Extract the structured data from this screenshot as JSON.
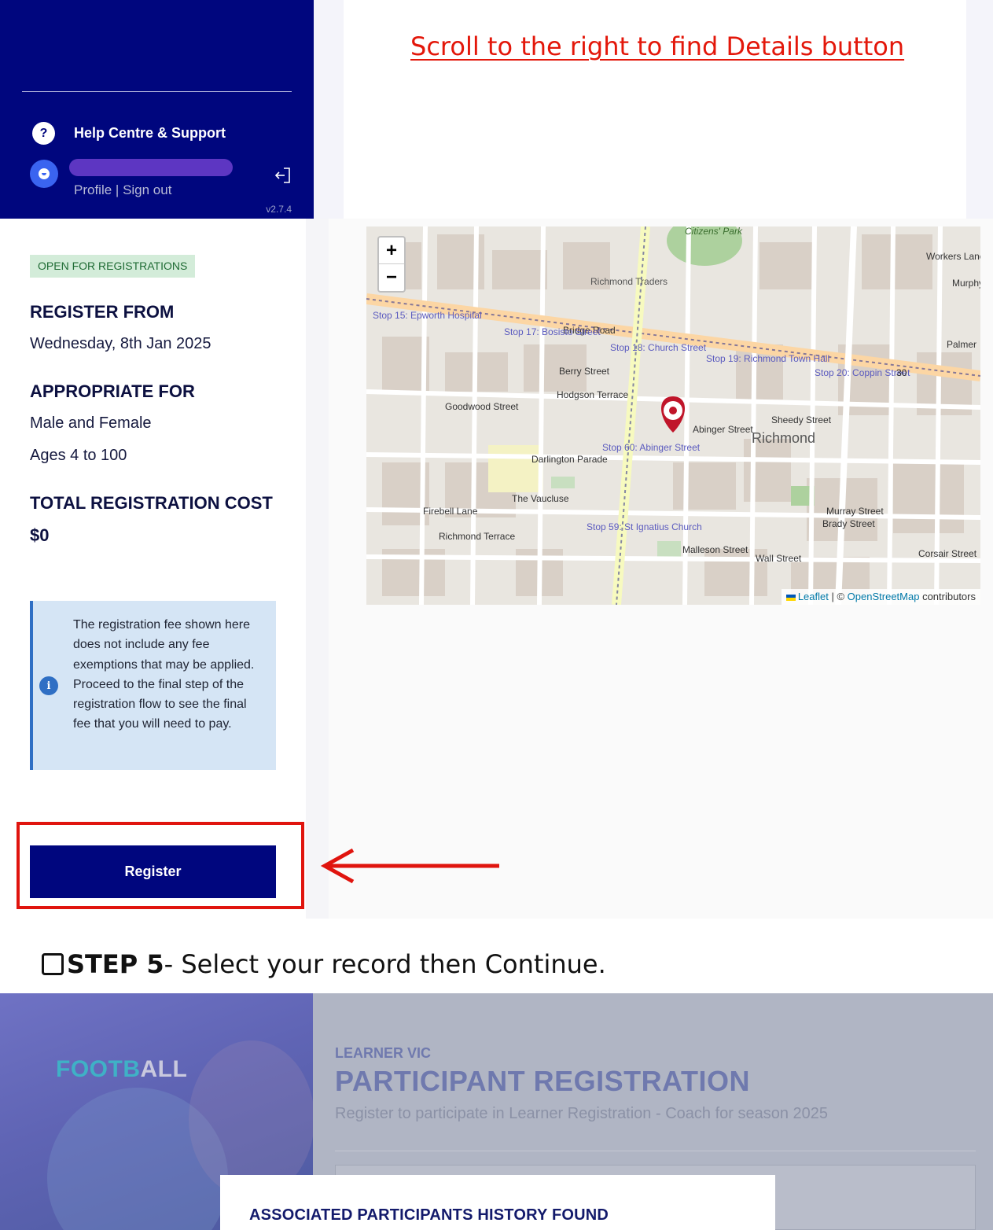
{
  "sidebar": {
    "help_label": "Help Centre & Support",
    "help_icon_glyph": "?",
    "profile_link": "Profile",
    "separator": " | ",
    "signout_link": "Sign out",
    "version": "v2.7.4"
  },
  "annotation": {
    "scroll_note": "Scroll to the right to find Details button"
  },
  "details": {
    "status_badge": "OPEN FOR REGISTRATIONS",
    "register_from_label": "REGISTER FROM",
    "register_from_value": "Wednesday, 8th Jan 2025",
    "appropriate_for_label": "APPROPRIATE FOR",
    "gender_value": "Male and Female",
    "ages_value": "Ages 4 to 100",
    "cost_label": "TOTAL REGISTRATION COST",
    "cost_value": "$0",
    "info_text": "The registration fee shown here does not include any fee exemptions that may be applied. Proceed to the final step of the registration flow to see the final fee that you will need to pay.",
    "info_icon_glyph": "i",
    "register_button": "Register"
  },
  "map": {
    "zoom_in": "+",
    "zoom_out": "−",
    "attribution_leaflet": "Leaflet",
    "attribution_sep": " | © ",
    "attribution_osm": "OpenStreetMap",
    "attribution_contributors": " contributors",
    "labels": {
      "citizens_park": "Citizens' Park",
      "richmond_traders": "Richmond Traders",
      "bridge_road": "Bridge Road",
      "stop15": "Stop 15: Epworth Hospital",
      "stop17": "Stop 17: Bosisto Street",
      "stop18": "Stop 18: Church Street",
      "stop19": "Stop 19: Richmond Town Hall",
      "stop20": "Stop 20: Coppin Street",
      "stop59": "Stop 59: St Ignatius Church",
      "stop60": "Stop 60: Abinger Street",
      "berry": "Berry Street",
      "hodgson": "Hodgson Terrace",
      "goodwood": "Goodwood Street",
      "abinger": "Abinger Street",
      "richmond": "Richmond",
      "sheedy": "Sheedy Street",
      "darlington": "Darlington Parade",
      "vaucluse": "The Vaucluse",
      "firebell": "Firebell Lane",
      "richmond_terrace": "Richmond Terrace",
      "malleson": "Malleson Street",
      "wall": "Wall Street",
      "murray": "Murray Street",
      "brady": "Brady Street",
      "corsair": "Corsair Street",
      "workers": "Workers Lane",
      "palmer": "Palmer",
      "murphy": "Murphy",
      "road_30": "30"
    }
  },
  "step": {
    "bold": "STEP 5",
    "rest": " - Select your record then Continue."
  },
  "registration": {
    "brand_part1": "FOOTB",
    "brand_part2": "ALL",
    "org": "LEARNER VIC",
    "title": "PARTICIPANT REGISTRATION",
    "subtitle": "Register to participate in Learner Registration - Coach for season 2025",
    "modal_title": "ASSOCIATED PARTICIPANTS HISTORY FOUND"
  },
  "colors": {
    "brand_navy": "#00067e",
    "accent_red": "#e0140e",
    "info_blue": "#2f6fc4"
  }
}
